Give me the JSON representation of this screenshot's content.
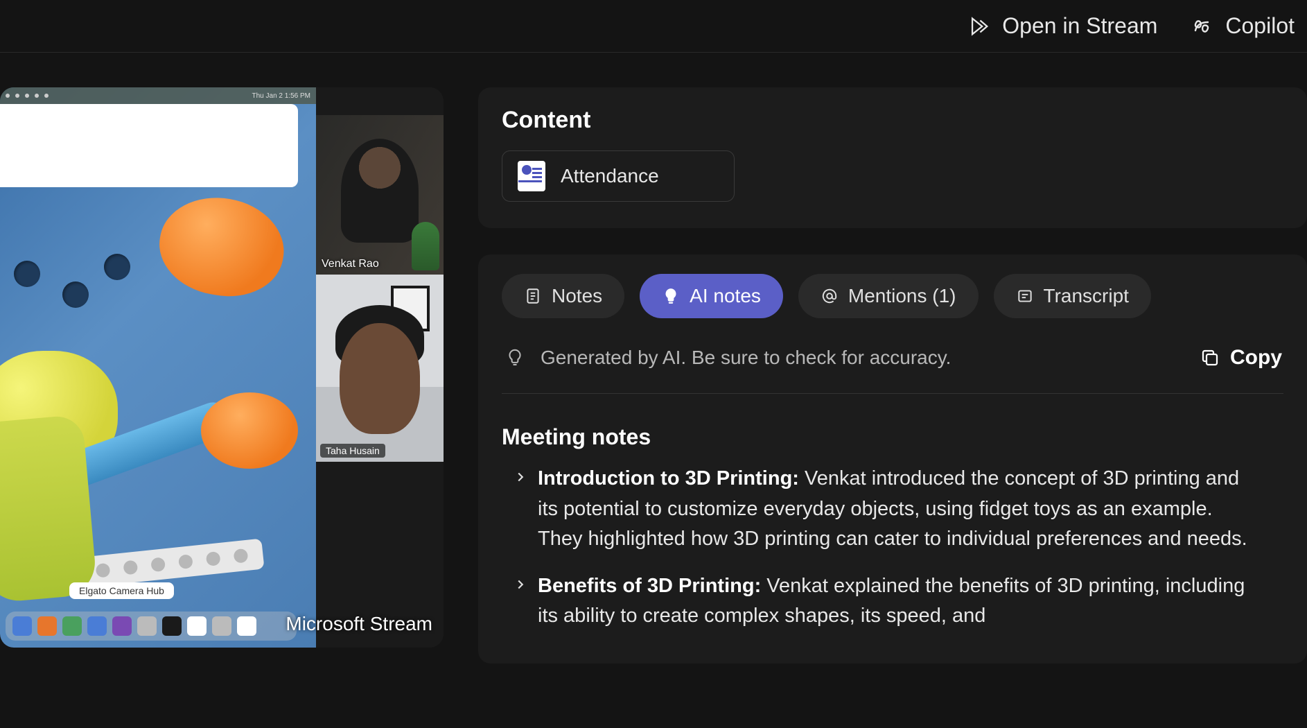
{
  "topbar": {
    "open_in_stream": "Open in Stream",
    "copilot": "Copilot"
  },
  "video": {
    "menubar_time": "Thu Jan 2  1:56 PM",
    "camera_hub_label": "Elgato Camera Hub",
    "participant1_name": "Venkat Rao",
    "participant2_tag": "Taha Husain",
    "overlay": "Microsoft Stream"
  },
  "content": {
    "heading": "Content",
    "attendance_label": "Attendance"
  },
  "tabs": {
    "notes": "Notes",
    "ai_notes": "AI notes",
    "mentions": "Mentions (1)",
    "transcript": "Transcript"
  },
  "ai_banner": {
    "text": "Generated by AI. Be sure to check for accuracy.",
    "copy": "Copy"
  },
  "meeting_notes": {
    "heading": "Meeting notes",
    "items": [
      {
        "title": "Introduction to 3D Printing:",
        "body": "Venkat introduced the concept of 3D printing and its potential to customize everyday objects, using fidget toys as an example. They highlighted how 3D printing can cater to individual preferences and needs."
      },
      {
        "title": "Benefits of 3D Printing:",
        "body": "Venkat explained the benefits of 3D printing, including its ability to create complex shapes, its speed, and"
      }
    ]
  }
}
